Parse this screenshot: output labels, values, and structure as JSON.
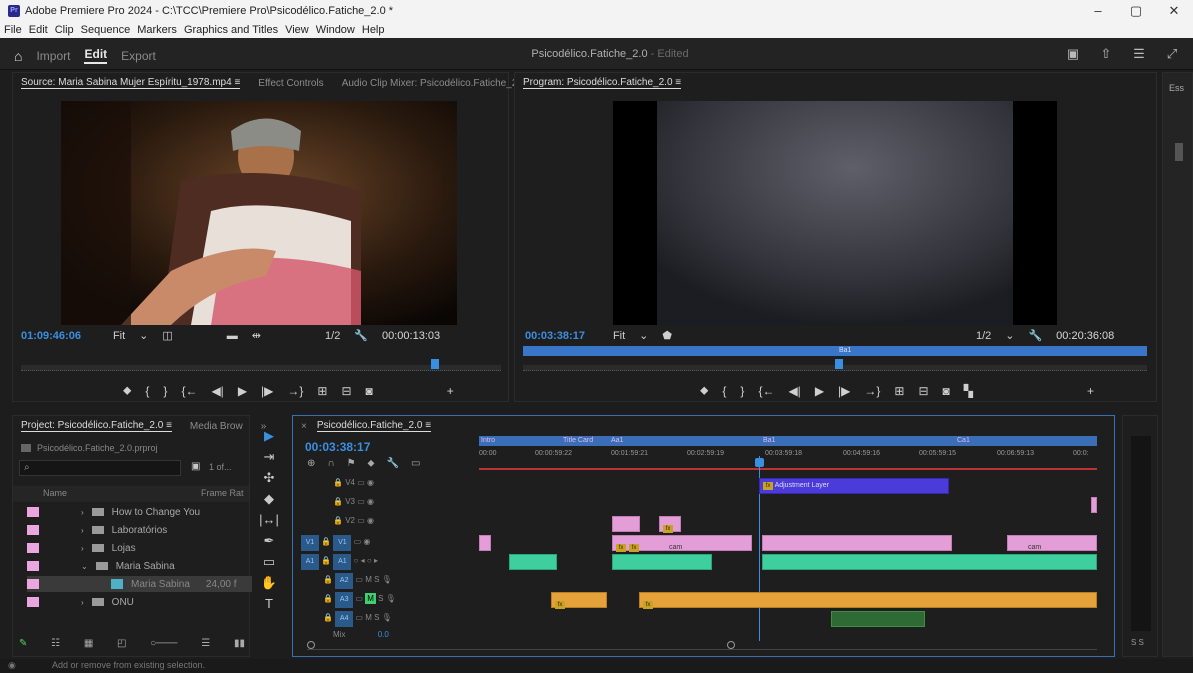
{
  "window": {
    "title": "Adobe Premiere Pro 2024 - C:\\TCC\\Premiere Pro\\Psicodélico.Fatiche_2.0 *",
    "minimize": "–",
    "maximize": "▢",
    "close": "✕"
  },
  "menu": [
    "File",
    "Edit",
    "Clip",
    "Sequence",
    "Markers",
    "Graphics and Titles",
    "View",
    "Window",
    "Help"
  ],
  "header": {
    "nav": {
      "import": "Import",
      "edit": "Edit",
      "export": "Export"
    },
    "project_name": "Psicodélico.Fatiche_2.0",
    "project_status": "- Edited",
    "icons": [
      "quick-export-icon",
      "share-icon",
      "panels-icon",
      "fullscreen-icon"
    ]
  },
  "source_panel": {
    "tabs": [
      "Source: Maria Sabina Mujer Espíritu_1978.mp4 ≡",
      "Effect Controls",
      "Audio Clip Mixer: Psicodélico.Fatiche_2.0",
      "»"
    ],
    "timecode": "01:09:46:06",
    "fit": "Fit",
    "resolution": "1/2",
    "duration": "00:00:13:03"
  },
  "program_panel": {
    "tab": "Program: Psicodélico.Fatiche_2.0 ≡",
    "timecode": "00:03:38:17",
    "fit": "Fit",
    "resolution": "1/2",
    "duration": "00:20:36:08",
    "marker_label": "Ba1"
  },
  "project_panel": {
    "tabs": [
      "Project: Psicodélico.Fatiche_2.0 ≡",
      "Media Brow",
      "»"
    ],
    "file": "Psicodélico.Fatiche_2.0.prproj",
    "count": "1 of...",
    "col_name": "Name",
    "col_rate": "Frame Rat",
    "items": [
      {
        "name": "How to Change You",
        "type": "folder"
      },
      {
        "name": "Laboratórios",
        "type": "folder"
      },
      {
        "name": "Lojas",
        "type": "folder"
      },
      {
        "name": "Maria Sabina",
        "type": "folder"
      },
      {
        "name": "Maria Sabina",
        "rate": "24,00 f",
        "type": "clip"
      },
      {
        "name": "ONU",
        "type": "folder"
      }
    ]
  },
  "timeline": {
    "tab": "Psicodélico.Fatiche_2.0 ≡",
    "timecode": "00:03:38:17",
    "ruler": [
      "00:00",
      "00:00:59:22",
      "00:01:59:21",
      "00:02:59:19",
      "00:03:59:18",
      "00:04:59:16",
      "00:05:59:15",
      "00:06:59:13",
      "00:0:"
    ],
    "markers": [
      "Intro",
      "Title Card",
      "Aa1",
      "Ba1",
      "Ca1"
    ],
    "tracks": [
      "V4",
      "V3",
      "V2",
      "V1",
      "A1",
      "A2",
      "A3",
      "A4",
      "Mix"
    ],
    "adjustment_label": "Adjustment Layer",
    "mix_value": "0.0",
    "cam_label": "cam",
    "meter_label": "S S"
  },
  "essentials_label": "Ess",
  "status_text": "Add or remove from existing selection."
}
